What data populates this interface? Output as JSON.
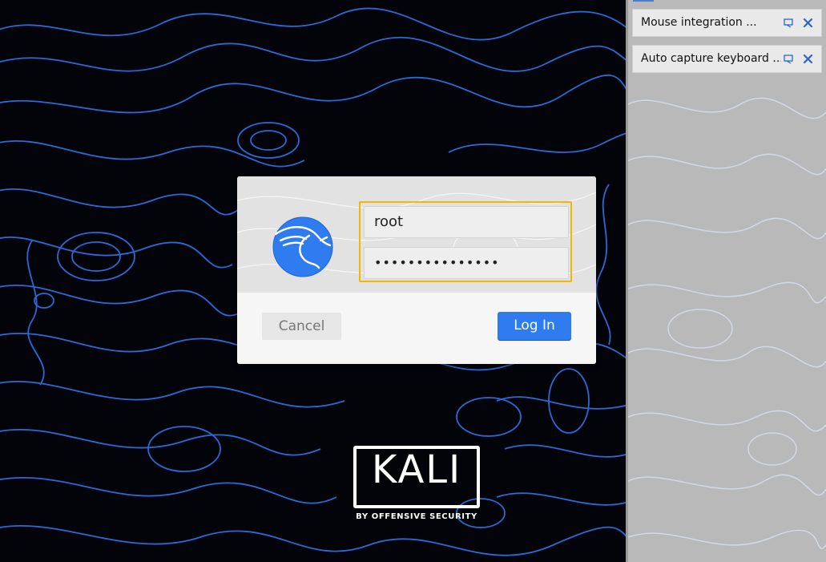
{
  "side_panel": {
    "notifications": [
      {
        "text": "Mouse integration ..."
      },
      {
        "text": "Auto capture keyboard ..."
      }
    ]
  },
  "login": {
    "username": "root",
    "password_masked": "•••••••••••••••",
    "cancel_label": "Cancel",
    "login_label": "Log In"
  },
  "branding": {
    "word": "KALI",
    "tagline": "BY OFFENSIVE SECURITY"
  },
  "colors": {
    "accent_blue": "#2f7cf0",
    "focus_outline": "#f2b705",
    "topo_line": "#2f6fe0"
  },
  "icons": [
    "pin-icon",
    "close-icon",
    "kali-dragon-icon"
  ]
}
